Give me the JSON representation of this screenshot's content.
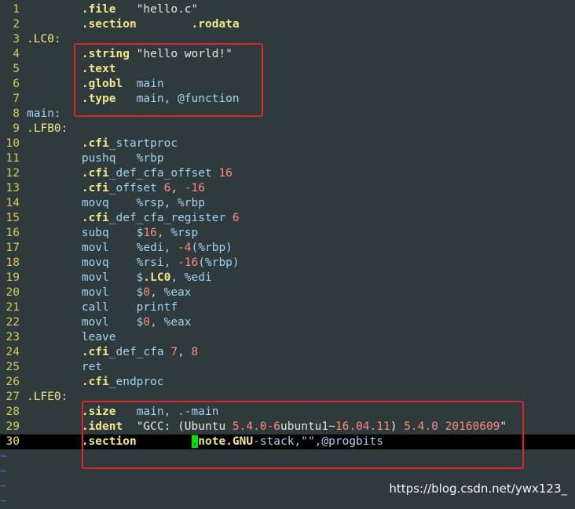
{
  "editor": {
    "lines": [
      {
        "n": "1",
        "code": [
          [
            "        ",
            "dft"
          ],
          [
            ".file",
            "dir"
          ],
          [
            "   \"hello.c\"",
            "str"
          ]
        ]
      },
      {
        "n": "2",
        "code": [
          [
            "        ",
            "dft"
          ],
          [
            ".section",
            "dir"
          ],
          [
            "        ",
            "dft"
          ],
          [
            ".rodata",
            "dir"
          ]
        ]
      },
      {
        "n": "3",
        "code": [
          [
            ".LC0",
            "label"
          ],
          [
            ":",
            "dft"
          ]
        ]
      },
      {
        "n": "4",
        "code": [
          [
            "        ",
            "dft"
          ],
          [
            ".string",
            "dir"
          ],
          [
            " \"hello world!\"",
            "str"
          ]
        ]
      },
      {
        "n": "5",
        "code": [
          [
            "        ",
            "dft"
          ],
          [
            ".text",
            "dir"
          ]
        ]
      },
      {
        "n": "6",
        "code": [
          [
            "        ",
            "dft"
          ],
          [
            ".globl",
            "dir"
          ],
          [
            "  main",
            "mn"
          ]
        ]
      },
      {
        "n": "7",
        "code": [
          [
            "        ",
            "dft"
          ],
          [
            ".type",
            "dir"
          ],
          [
            "   main, @function",
            "mn"
          ]
        ]
      },
      {
        "n": "8",
        "code": [
          [
            "main:",
            "mn"
          ]
        ]
      },
      {
        "n": "9",
        "code": [
          [
            ".LFB0",
            "label"
          ],
          [
            ":",
            "dft"
          ]
        ]
      },
      {
        "n": "10",
        "code": [
          [
            "        ",
            "dft"
          ],
          [
            ".cfi",
            "dir"
          ],
          [
            "_startproc",
            "mn"
          ]
        ]
      },
      {
        "n": "11",
        "code": [
          [
            "        pushq   %rbp",
            "mn"
          ]
        ]
      },
      {
        "n": "12",
        "code": [
          [
            "        ",
            "dft"
          ],
          [
            ".cfi",
            "dir"
          ],
          [
            "_def_cfa_offset ",
            "mn"
          ],
          [
            "16",
            "num"
          ]
        ]
      },
      {
        "n": "13",
        "code": [
          [
            "        ",
            "dft"
          ],
          [
            ".cfi",
            "dir"
          ],
          [
            "_offset ",
            "mn"
          ],
          [
            "6",
            "num"
          ],
          [
            ", ",
            "dft"
          ],
          [
            "-16",
            "num"
          ]
        ]
      },
      {
        "n": "14",
        "code": [
          [
            "        movq    %rsp, %rbp",
            "mn"
          ]
        ]
      },
      {
        "n": "15",
        "code": [
          [
            "        ",
            "dft"
          ],
          [
            ".cfi",
            "dir"
          ],
          [
            "_def_cfa_register ",
            "mn"
          ],
          [
            "6",
            "num"
          ]
        ]
      },
      {
        "n": "16",
        "code": [
          [
            "        subq    $",
            "mn"
          ],
          [
            "16",
            "num"
          ],
          [
            ", %rsp",
            "mn"
          ]
        ]
      },
      {
        "n": "17",
        "code": [
          [
            "        movl    %edi, ",
            "mn"
          ],
          [
            "-4",
            "num"
          ],
          [
            "(%rbp)",
            "mn"
          ]
        ]
      },
      {
        "n": "18",
        "code": [
          [
            "        movq    %rsi, ",
            "mn"
          ],
          [
            "-16",
            "num"
          ],
          [
            "(%rbp)",
            "mn"
          ]
        ]
      },
      {
        "n": "19",
        "code": [
          [
            "        movl    $",
            "mn"
          ],
          [
            ".LC0",
            "dir"
          ],
          [
            ", %edi",
            "mn"
          ]
        ]
      },
      {
        "n": "20",
        "code": [
          [
            "        movl    $",
            "mn"
          ],
          [
            "0",
            "num"
          ],
          [
            ", %eax",
            "mn"
          ]
        ]
      },
      {
        "n": "21",
        "code": [
          [
            "        call    printf",
            "mn"
          ]
        ]
      },
      {
        "n": "22",
        "code": [
          [
            "        movl    $",
            "mn"
          ],
          [
            "0",
            "num"
          ],
          [
            ", %eax",
            "mn"
          ]
        ]
      },
      {
        "n": "23",
        "code": [
          [
            "        leave",
            "mn"
          ]
        ]
      },
      {
        "n": "24",
        "code": [
          [
            "        ",
            "dft"
          ],
          [
            ".cfi",
            "dir"
          ],
          [
            "_def_cfa ",
            "mn"
          ],
          [
            "7",
            "num"
          ],
          [
            ", ",
            "dft"
          ],
          [
            "8",
            "num"
          ]
        ]
      },
      {
        "n": "25",
        "code": [
          [
            "        ret",
            "mn"
          ]
        ]
      },
      {
        "n": "26",
        "code": [
          [
            "        ",
            "dft"
          ],
          [
            ".cfi",
            "dir"
          ],
          [
            "_endproc",
            "mn"
          ]
        ]
      },
      {
        "n": "27",
        "code": [
          [
            ".LFE0",
            "label"
          ],
          [
            ":",
            "dft"
          ]
        ]
      },
      {
        "n": "28",
        "code": [
          [
            "        ",
            "dft"
          ],
          [
            ".size",
            "dir"
          ],
          [
            "   main, .-main",
            "mn"
          ]
        ]
      },
      {
        "n": "29",
        "code": [
          [
            "        ",
            "dft"
          ],
          [
            ".ident",
            "dir"
          ],
          [
            "  \"GCC: (Ubuntu ",
            "str"
          ],
          [
            "5.4.0-6",
            "num"
          ],
          [
            "ubuntu1~",
            "str"
          ],
          [
            "16.04.11",
            "num"
          ],
          [
            ") ",
            "str"
          ],
          [
            "5.4.0 20160609",
            "num"
          ],
          [
            "\"",
            "str"
          ]
        ]
      },
      {
        "n": "30",
        "code": [
          [
            "        ",
            "dft"
          ],
          [
            ".section",
            "dir"
          ],
          [
            "        ",
            "dft"
          ],
          [
            ".",
            "cursor"
          ],
          [
            "note",
            "dir"
          ],
          [
            ".GNU",
            "dir"
          ],
          [
            "-stack,\"\",@progbits",
            "mn"
          ]
        ],
        "current": true
      }
    ],
    "tilde_char": "~",
    "tilde_count": 4
  },
  "watermark": "https://blog.csdn.net/ywx123_",
  "colors": {
    "background": "#2f3a3d",
    "highlight_box": "#e3232a",
    "cursor": "#00e600"
  }
}
